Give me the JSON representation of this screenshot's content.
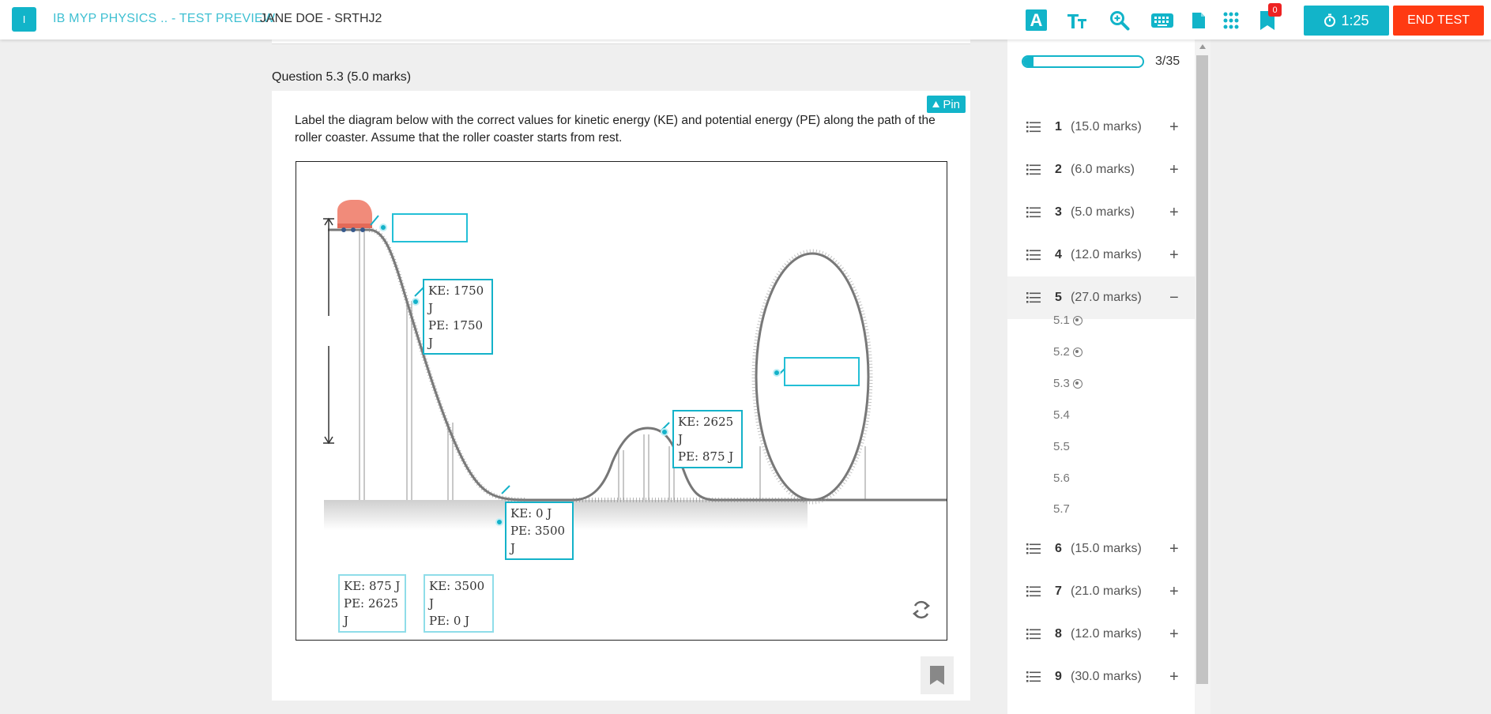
{
  "header": {
    "badge": "I",
    "test_title": "IB MYP PHYSICS .. - TEST PREVIEW",
    "student": "JANE DOE - SRTHJ2",
    "tools": {
      "font_style": "A",
      "text_size": "tT",
      "zoom_icon": "zoom-icon",
      "keyboard_icon": "keyboard-icon",
      "notes_icon": "document-icon",
      "grid_icon": "grid-icon",
      "flag_icon": "bookmark-icon"
    },
    "flag_count": "0",
    "timer": "1:25",
    "end_test": "END TEST"
  },
  "question": {
    "heading": "Question 5.3   (5.0 marks)",
    "pin_label": "Pin",
    "text": "Label the diagram below with the correct values for kinetic energy (KE) and potential energy (PE) along the path of the roller coaster. Assume that the roller coaster starts from rest.",
    "placed_labels": [
      {
        "ke": "KE: 1750 J",
        "pe": "PE: 1750 J"
      },
      {
        "ke": "KE: 0 J",
        "pe": "PE: 3500 J"
      },
      {
        "ke": "KE: 2625 J",
        "pe": "PE: 875 J"
      }
    ],
    "bank_labels": [
      {
        "ke": "KE: 875 J",
        "pe": "PE: 2625 J"
      },
      {
        "ke": "KE: 3500 J",
        "pe": "PE: 0 J"
      }
    ]
  },
  "nav": {
    "progress": {
      "current": 3,
      "total": 35,
      "text": "3/35",
      "fraction": 0.0857
    },
    "sections": [
      {
        "num": "1",
        "marks": "(15.0 marks)",
        "toggle": "+"
      },
      {
        "num": "2",
        "marks": "(6.0 marks)",
        "toggle": "+"
      },
      {
        "num": "3",
        "marks": "(5.0 marks)",
        "toggle": "+"
      },
      {
        "num": "4",
        "marks": "(12.0 marks)",
        "toggle": "+"
      },
      {
        "num": "5",
        "marks": "(27.0 marks)",
        "toggle": "−"
      },
      {
        "num": "6",
        "marks": "(15.0 marks)",
        "toggle": "+"
      },
      {
        "num": "7",
        "marks": "(21.0 marks)",
        "toggle": "+"
      },
      {
        "num": "8",
        "marks": "(12.0 marks)",
        "toggle": "+"
      },
      {
        "num": "9",
        "marks": "(30.0 marks)",
        "toggle": "+"
      }
    ],
    "sub_items": [
      {
        "label": "5.1",
        "answered": true
      },
      {
        "label": "5.2",
        "answered": true
      },
      {
        "label": "5.3",
        "answered": true
      },
      {
        "label": "5.4",
        "answered": false
      },
      {
        "label": "5.5",
        "answered": false
      },
      {
        "label": "5.6",
        "answered": false
      },
      {
        "label": "5.7",
        "answered": false
      }
    ]
  },
  "colors": {
    "accent": "#12b4c9",
    "danger": "#ff3a12",
    "flag_badge": "#ee2222"
  }
}
